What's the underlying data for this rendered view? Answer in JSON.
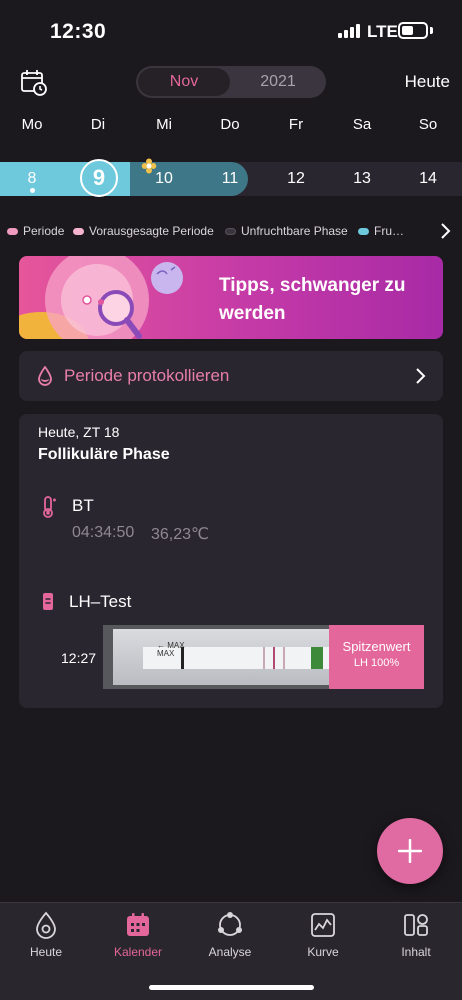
{
  "status_bar": {
    "time": "12:30",
    "network": "LTE"
  },
  "header": {
    "month": "Nov",
    "year": "2021",
    "today_button": "Heute"
  },
  "weekdays": [
    "Mo",
    "Di",
    "Mi",
    "Do",
    "Fr",
    "Sa",
    "So"
  ],
  "week_days": [
    {
      "day": "8",
      "state": "period"
    },
    {
      "day": "9",
      "state": "today"
    },
    {
      "day": "10",
      "state": "fertile-ovulation"
    },
    {
      "day": "11",
      "state": "fertile"
    },
    {
      "day": "12",
      "state": "normal"
    },
    {
      "day": "13",
      "state": "normal"
    },
    {
      "day": "14",
      "state": "normal"
    }
  ],
  "legend": [
    {
      "label": "Periode",
      "color": "#f19ac0"
    },
    {
      "label": "Vorausgesagte Periode",
      "color": "#f4b3cf"
    },
    {
      "label": "Unfruchtbare Phase",
      "color": "#3a353e"
    },
    {
      "label": "Fru…",
      "color": "#6ec9dc"
    }
  ],
  "banner": {
    "title": "Tipps, schwanger zu werden"
  },
  "log_period": {
    "label": "Periode protokollieren"
  },
  "today_card": {
    "subtitle": "Heute, ZT 18",
    "phase": "Follikuläre Phase",
    "bt": {
      "label": "BT",
      "time": "04:34:50",
      "value": "36,23℃"
    },
    "lh": {
      "label": "LH–Test",
      "time": "12:27",
      "badge_title": "Spitzenwert",
      "badge_value": "LH 100%",
      "strip_text": "MAX"
    }
  },
  "tabs": [
    {
      "label": "Heute",
      "icon": "drop-circle-icon",
      "active": false
    },
    {
      "label": "Kalender",
      "icon": "calendar-icon",
      "active": true
    },
    {
      "label": "Analyse",
      "icon": "analysis-icon",
      "active": false
    },
    {
      "label": "Kurve",
      "icon": "chart-icon",
      "active": false
    },
    {
      "label": "Inhalt",
      "icon": "content-grid-icon",
      "active": false
    }
  ],
  "colors": {
    "accent": "#e3679b",
    "period": "#6ec9dc",
    "fertile": "#3e7888",
    "card": "#2a2630",
    "background": "#1c191e"
  }
}
